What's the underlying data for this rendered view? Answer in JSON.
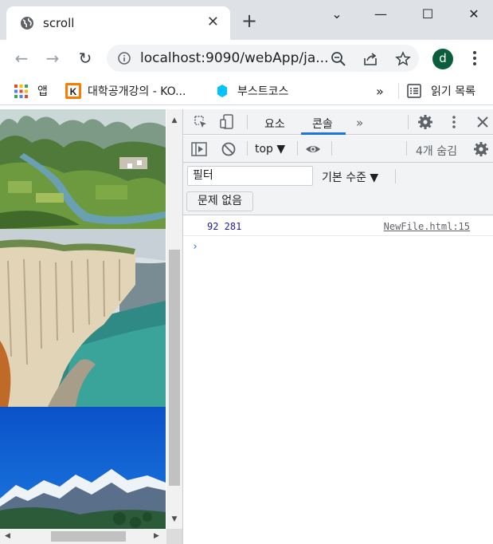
{
  "tab": {
    "title": "scroll",
    "close": "✕"
  },
  "window": {
    "minimize": "—",
    "maximize": "☐",
    "close": "✕",
    "dropdown": "⌄"
  },
  "toolbar": {
    "url": "localhost:9090/webApp/ja...",
    "avatar_letter": "d"
  },
  "bookmarks": {
    "apps_label": "앱",
    "items": [
      {
        "label": "대학공개강의 - KO...",
        "icon": "kocw-icon"
      },
      {
        "label": "부스트코스",
        "icon": "boostcourse-icon"
      }
    ],
    "overflow": "»",
    "reading_list": "읽기 목록"
  },
  "devtools": {
    "tabs": [
      {
        "label": "요소"
      },
      {
        "label": "콘솔"
      }
    ],
    "more_tabs": "»",
    "context": "top ▼",
    "hidden_count": "4개 숨김",
    "filter_placeholder": "필터",
    "level": "기본 수준 ▼",
    "issues": "문제 없음",
    "console": [
      {
        "message": "92 281",
        "source": "NewFile.html:15"
      }
    ],
    "prompt": "›"
  },
  "colors": {
    "accent": "#1a73e8",
    "tab_bar": "#dee1e6",
    "avatar": "#0b5e3b"
  }
}
